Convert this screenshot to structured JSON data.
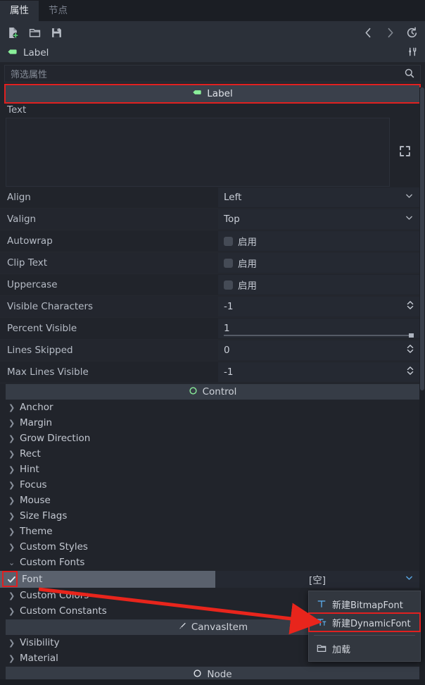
{
  "tabs": [
    {
      "label": "属性",
      "active": true,
      "name": "tab-properties"
    },
    {
      "label": "节点",
      "active": false,
      "name": "tab-node"
    }
  ],
  "toolbar": {
    "new_resource": "new-resource-icon",
    "open_resource": "open-folder-icon",
    "save_resource": "save-icon",
    "back": "back-arrow-icon",
    "forward": "forward-arrow-icon",
    "history": "history-icon"
  },
  "node_header": {
    "name": "Label",
    "icon": "label-node-icon",
    "tools_icon": "object-tools-icon"
  },
  "filter": {
    "placeholder": "筛选属性",
    "value": "",
    "search_icon": "search-icon"
  },
  "class_banner": {
    "label": "Label",
    "icon": "label-node-icon",
    "highlighted": true
  },
  "text_property": {
    "label": "Text",
    "value": "",
    "expand_icon": "expand-icon"
  },
  "properties": [
    {
      "label": "Align",
      "type": "enum",
      "value": "Left"
    },
    {
      "label": "Valign",
      "type": "enum",
      "value": "Top"
    },
    {
      "label": "Autowrap",
      "type": "checkbox",
      "value": "启用",
      "checked": false
    },
    {
      "label": "Clip Text",
      "type": "checkbox",
      "value": "启用",
      "checked": false
    },
    {
      "label": "Uppercase",
      "type": "checkbox",
      "value": "启用",
      "checked": false
    },
    {
      "label": "Visible Characters",
      "type": "spin",
      "value": "-1"
    },
    {
      "label": "Percent Visible",
      "type": "slider",
      "value": "1"
    },
    {
      "label": "Lines Skipped",
      "type": "spin",
      "value": "0"
    },
    {
      "label": "Max Lines Visible",
      "type": "spin",
      "value": "-1"
    }
  ],
  "sections": {
    "control": {
      "label": "Control",
      "icon": "control-node-icon"
    },
    "canvasitem": {
      "label": "CanvasItem",
      "icon": "canvasitem-node-icon"
    },
    "node": {
      "label": "Node",
      "icon": "node-icon"
    }
  },
  "control_groups": [
    {
      "label": "Anchor",
      "expanded": false
    },
    {
      "label": "Margin",
      "expanded": false
    },
    {
      "label": "Grow Direction",
      "expanded": false
    },
    {
      "label": "Rect",
      "expanded": false
    },
    {
      "label": "Hint",
      "expanded": false
    },
    {
      "label": "Focus",
      "expanded": false
    },
    {
      "label": "Mouse",
      "expanded": false
    },
    {
      "label": "Size Flags",
      "expanded": false
    },
    {
      "label": "Theme",
      "expanded": false
    },
    {
      "label": "Custom Styles",
      "expanded": false
    },
    {
      "label": "Custom Fonts",
      "expanded": true
    }
  ],
  "font_row": {
    "label": "Font",
    "value": "[空]",
    "checked": true,
    "checkbox_highlighted": true,
    "chevron_icon": "chevron-down-icon"
  },
  "control_groups_after": [
    {
      "label": "Custom Colors",
      "expanded": false
    },
    {
      "label": "Custom Constants",
      "expanded": false
    }
  ],
  "canvasitem_groups": [
    {
      "label": "Visibility",
      "expanded": false
    },
    {
      "label": "Material",
      "expanded": false
    }
  ],
  "popup_menu": {
    "items": [
      {
        "label": "新建BitmapFont",
        "icon": "bitmap-font-icon",
        "highlighted": false
      },
      {
        "label": "新建DynamicFont",
        "icon": "dynamic-font-icon",
        "highlighted": true
      },
      {
        "separator": true
      },
      {
        "label": "加载",
        "icon": "load-folder-icon",
        "highlighted": false
      }
    ]
  },
  "annotation": {
    "arrow_color": "#e8251c",
    "highlight_color": "#e02020"
  },
  "colors": {
    "panel_bg": "#21242b",
    "header_bg": "#2b3039",
    "section_bg": "#363c46",
    "selected_bg": "#5a616d",
    "accent_green": "#8aef9a",
    "accent_blue": "#5aa9e6",
    "text": "#c3c8d1",
    "text_dim": "#868d99"
  }
}
